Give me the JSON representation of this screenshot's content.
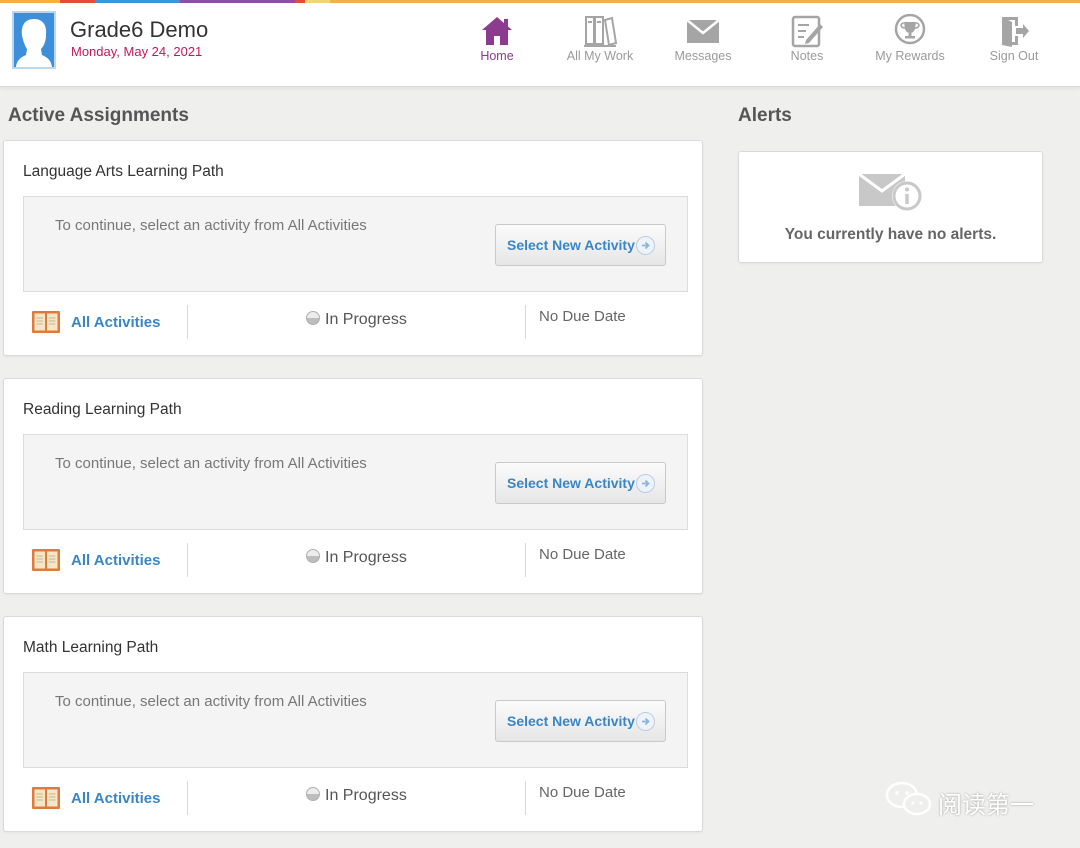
{
  "colors": {
    "accent_purple": "#8b3c8f",
    "link_blue": "#3a86c5",
    "date_pink": "#c2185b",
    "rainbow": [
      "#f3b23e",
      "#e84a3a",
      "#3a97d8",
      "#8f4fa5",
      "#f3b23e",
      "#f3d27a",
      "#f0b14a"
    ]
  },
  "user": {
    "name": "Grade6 Demo",
    "date": "Monday, May 24, 2021",
    "avatar_icon": "user-avatar-icon"
  },
  "nav": [
    {
      "label": "Home",
      "icon": "home-icon",
      "active": true
    },
    {
      "label": "All My Work",
      "icon": "binders-icon",
      "active": false
    },
    {
      "label": "Messages",
      "icon": "envelope-icon",
      "active": false
    },
    {
      "label": "Notes",
      "icon": "notepad-pencil-icon",
      "active": false
    },
    {
      "label": "My Rewards",
      "icon": "trophy-icon",
      "active": false
    },
    {
      "label": "Sign Out",
      "icon": "exit-door-icon",
      "active": false
    }
  ],
  "assignments": {
    "title": "Active Assignments",
    "items": [
      {
        "title": "Language Arts Learning Path",
        "message": "To continue, select an activity from All Activities",
        "button": "Select New Activity",
        "link": "All Activities",
        "status": "In Progress",
        "due": "No Due Date"
      },
      {
        "title": "Reading Learning Path",
        "message": "To continue, select an activity from All Activities",
        "button": "Select New Activity",
        "link": "All Activities",
        "status": "In Progress",
        "due": "No Due Date"
      },
      {
        "title": "Math Learning Path",
        "message": "To continue, select an activity from All Activities",
        "button": "Select New Activity",
        "link": "All Activities",
        "status": "In Progress",
        "due": "No Due Date"
      }
    ]
  },
  "alerts": {
    "title": "Alerts",
    "message": "You currently have no alerts.",
    "icon": "mail-info-icon"
  },
  "watermark": {
    "text": "阅读第一",
    "icon": "wechat-icon"
  }
}
